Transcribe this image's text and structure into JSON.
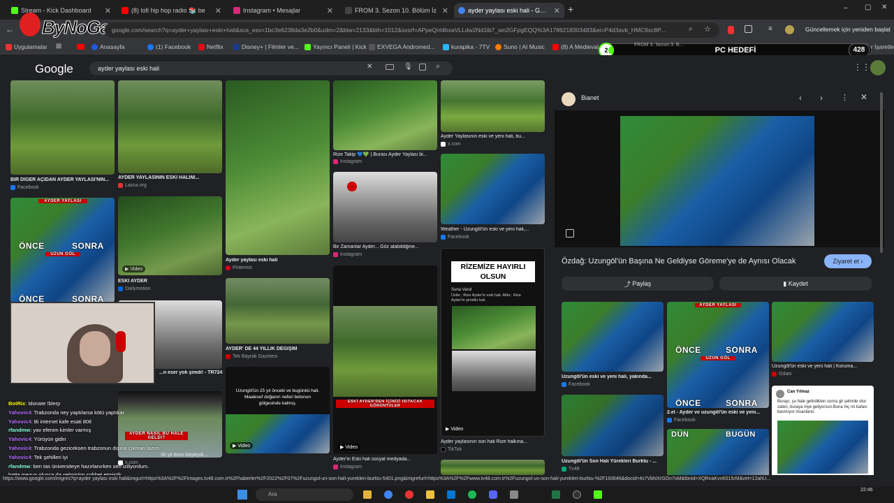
{
  "tabs": [
    {
      "label": "Stream - Kick Dashboard",
      "color": "#53fc18"
    },
    {
      "label": "(8) lofi hip hop radio 📚 be",
      "color": "#ff0000"
    },
    {
      "label": "Instagram • Mesajlar",
      "color": "#d62976"
    },
    {
      "label": "FROM 3. Sezon 10. Bölüm İz",
      "color": "#222"
    },
    {
      "label": "ayder yaylası eski hali - Google",
      "color": "#4285f4"
    }
  ],
  "address": {
    "url": "google.com/search?q=ayder+yaylası+eski+hali&sca_esv=1bc3e6238da3e2b0&udm=2&biw=2133&bih=1012&sxsrf=APpeQnt4bxaVLLdw2Nd1lb7_wn2GFpgEQQ%3A1786218303483&ei=P4d3avb_HMC9xc8P...",
    "update": "Güncellemek için yeniden başlat",
    "overlay_logo": "ByNoGame"
  },
  "bookmarks": [
    {
      "label": "Uygulamalar",
      "color": "#777"
    },
    {
      "label": "Anasayfa",
      "color": "#1e5bd8"
    },
    {
      "label": "(1) Facebook",
      "color": "#1877f2"
    },
    {
      "label": "Netflix",
      "color": "#e50914"
    },
    {
      "label": "Disney+ | Filmler ve...",
      "color": "#1a3a8a"
    },
    {
      "label": "Yayıncı Paneli | Kick",
      "color": "#53fc18"
    },
    {
      "label": "EXVEGA Andromed...",
      "color": "#555"
    },
    {
      "label": "kurapika - 7TV",
      "color": "#29b6f6"
    },
    {
      "label": "Suno | AI Music",
      "color": "#f57c00"
    },
    {
      "label": "(8) A Medieval",
      "color": "#ff0000"
    }
  ],
  "bookmark_tail": "Tüm Yer İşaretleri",
  "goal": {
    "count": "2",
    "label": "PC HEDEFİ",
    "value": "428",
    "fill_fraction": 0.02,
    "under": "FROM 3. Sezon 3. B..."
  },
  "google": {
    "logo": "Google",
    "query": "ayder yaylası eski hali"
  },
  "results": [
    {
      "caption": "BİR DİĞER AÇIDAN AYDER YAYLASI'NIN...",
      "source": "Facebook",
      "src_color": "#1877f2"
    },
    {
      "caption": "AYDER YAYLASININ ESKİ HALİNİ...",
      "source": "Lazca.org",
      "src_color": "#d33"
    },
    {
      "caption": "Ayder yaylası eski hali",
      "source": "Pinterest",
      "src_color": "#e60023"
    },
    {
      "caption": "Rize Takip 💙💚 | Burası Ayder Yaylası bi...",
      "source": "Instagram",
      "src_color": "#d62976"
    },
    {
      "caption": "Ayder Yaylasının eski ve yeni hali, bu...",
      "source": "x.com",
      "src_color": "#fff"
    },
    {
      "caption": "ESKİ AYDER",
      "source": "Dailymotion",
      "src_color": "#0066dc"
    },
    {
      "caption": "Bir Zamanlar Ayder... Göz alabildiğine...",
      "source": "Instagram",
      "src_color": "#d62976"
    },
    {
      "caption": "Weather - Uzungöl'ün eski ve yeni hali,...",
      "source": "Facebook",
      "src_color": "#1877f2"
    },
    {
      "caption": "...n eser yok şimdi! - TR724",
      "source": "",
      "src_color": "#000"
    },
    {
      "caption": "AYDER' DE 44 YILLIK DEĞİŞİM",
      "source": "Tek Bayrak Gazetesi",
      "src_color": "#c00"
    },
    {
      "caption": "Ayder'in Eski hali sosyal medyada...",
      "source": "Instagram",
      "src_color": "#d62976"
    },
    {
      "caption": "Ayder yaylasının son hali Rize halkına...",
      "source": "TikTok",
      "src_color": "#000"
    },
    {
      "caption": "30 yıl önce böyleydi....",
      "source": "x.com",
      "src_color": "#fff"
    }
  ],
  "overlays": {
    "ayder_yaylasi": "AYDER YAYLASI",
    "once": "ÖNCE",
    "sonra": "SONRA",
    "uzun_gol": "UZUN GÖL",
    "video": "Video",
    "rizemize": "RİZEMİZE HAYIRLI OLSUN",
    "tweet_user": "Suna Varol",
    "tweet_text": "Üstte ; Rize Ayder'in eski hali. Altta : Rize Ayder'in şimdiki hali.",
    "uzungol_text": "Uzungöl'ün 25 yıl önceki ve bugünkü hali. Maalesef doğanın neferi betonun gölgesinde kalmış.",
    "ayder_nasil": "AYDER NASIL BU HALE GELDİ?",
    "eski_ayder": "ESKİ AYDER'DEN İÇİNİZİ ISITACAK GÖRÜNTÜLER",
    "dun": "DÜN",
    "bugun": "BUGÜN"
  },
  "panel": {
    "source": "Bianet",
    "title": "Özdağ: Uzungöl'ün Başına Ne Geldiyse Göreme'ye de Aynısı Olacak",
    "visit": "Ziyaret et",
    "share": "Paylaş",
    "save": "Kaydet",
    "related": [
      {
        "caption": "Uzungöl'ün eski ve yeni hali, yakında...",
        "source": "Facebook",
        "src_color": "#1877f2"
      },
      {
        "caption": "2.el - Ayder ve uzungöl'ün eski ve yeni...",
        "source": "Facebook",
        "src_color": "#1877f2"
      },
      {
        "caption": "Uzungöl'ün eski ve yeni hali | Koruma...",
        "source": "Odatv",
        "src_color": "#c00"
      },
      {
        "caption": "Uzungöl'ün Son Hali Yürekleri Burktu - ...",
        "source": "Tv48",
        "src_color": "#0a7"
      }
    ],
    "tweet_name": "Can Yılmaz",
    "tweet_text": "Burayı, şu hale getirdikten sonra git şehirde otur zaten, buraya niye geliyorsun.Buna hiç mi kafası basmıyor insanların."
  },
  "chat": [
    {
      "user": "BotRix",
      "msg": ": Idonate !blerp",
      "color": "#ff0"
    },
    {
      "user": "Yahovic4",
      "msg": ": Trabzonda ney yaptılarsa kötü yaptıkar",
      "color": "#b56cff"
    },
    {
      "user": "Yahovic4",
      "msg": ": Bi internet kafe esati 80tl",
      "color": "#b56cff"
    },
    {
      "user": "rfandmw",
      "msg": ": yav efenim kimler varmış",
      "color": "#8fd"
    },
    {
      "user": "Yahovic4",
      "msg": ": Yürüyün gidin",
      "color": "#b56cff"
    },
    {
      "user": "Yahovic4",
      "msg": ": Trabzonda geziceksen trabzonun dışına çıkman lazım",
      "color": "#b56cff"
    },
    {
      "user": "Yahovic4",
      "msg": ": Tek şehilleri iyi",
      "color": "#b56cff"
    },
    {
      "user": "rfandmw",
      "msg": ": ben tas üniversiteye hazırlanırken sen iziliyordum. hatta mezun olunca da gelmiştim sohbet etmiştik",
      "color": "#8fd"
    }
  ],
  "status": "https://www.google.com/imgres?q=ayder yaylası eski hali&imgurl=https%3A%2F%2Fimages.tv48.com.tr%2Fhaberler%2F2022%2F07%2Fuzungol-un-son-hali-yurekleri-burktu-5401.png&imgrefurl=https%3A%2F%2Fwww.tv48.com.tr%2Fuzungol-un-son-hali-yurekleri-burktu-%2F193646&docid=4s7VbNXrGOn7oM&tbnid=XQRnaKvv6S15rM&vet=12ahU...",
  "taskbar": {
    "search": "Ara",
    "time": "22:46"
  }
}
